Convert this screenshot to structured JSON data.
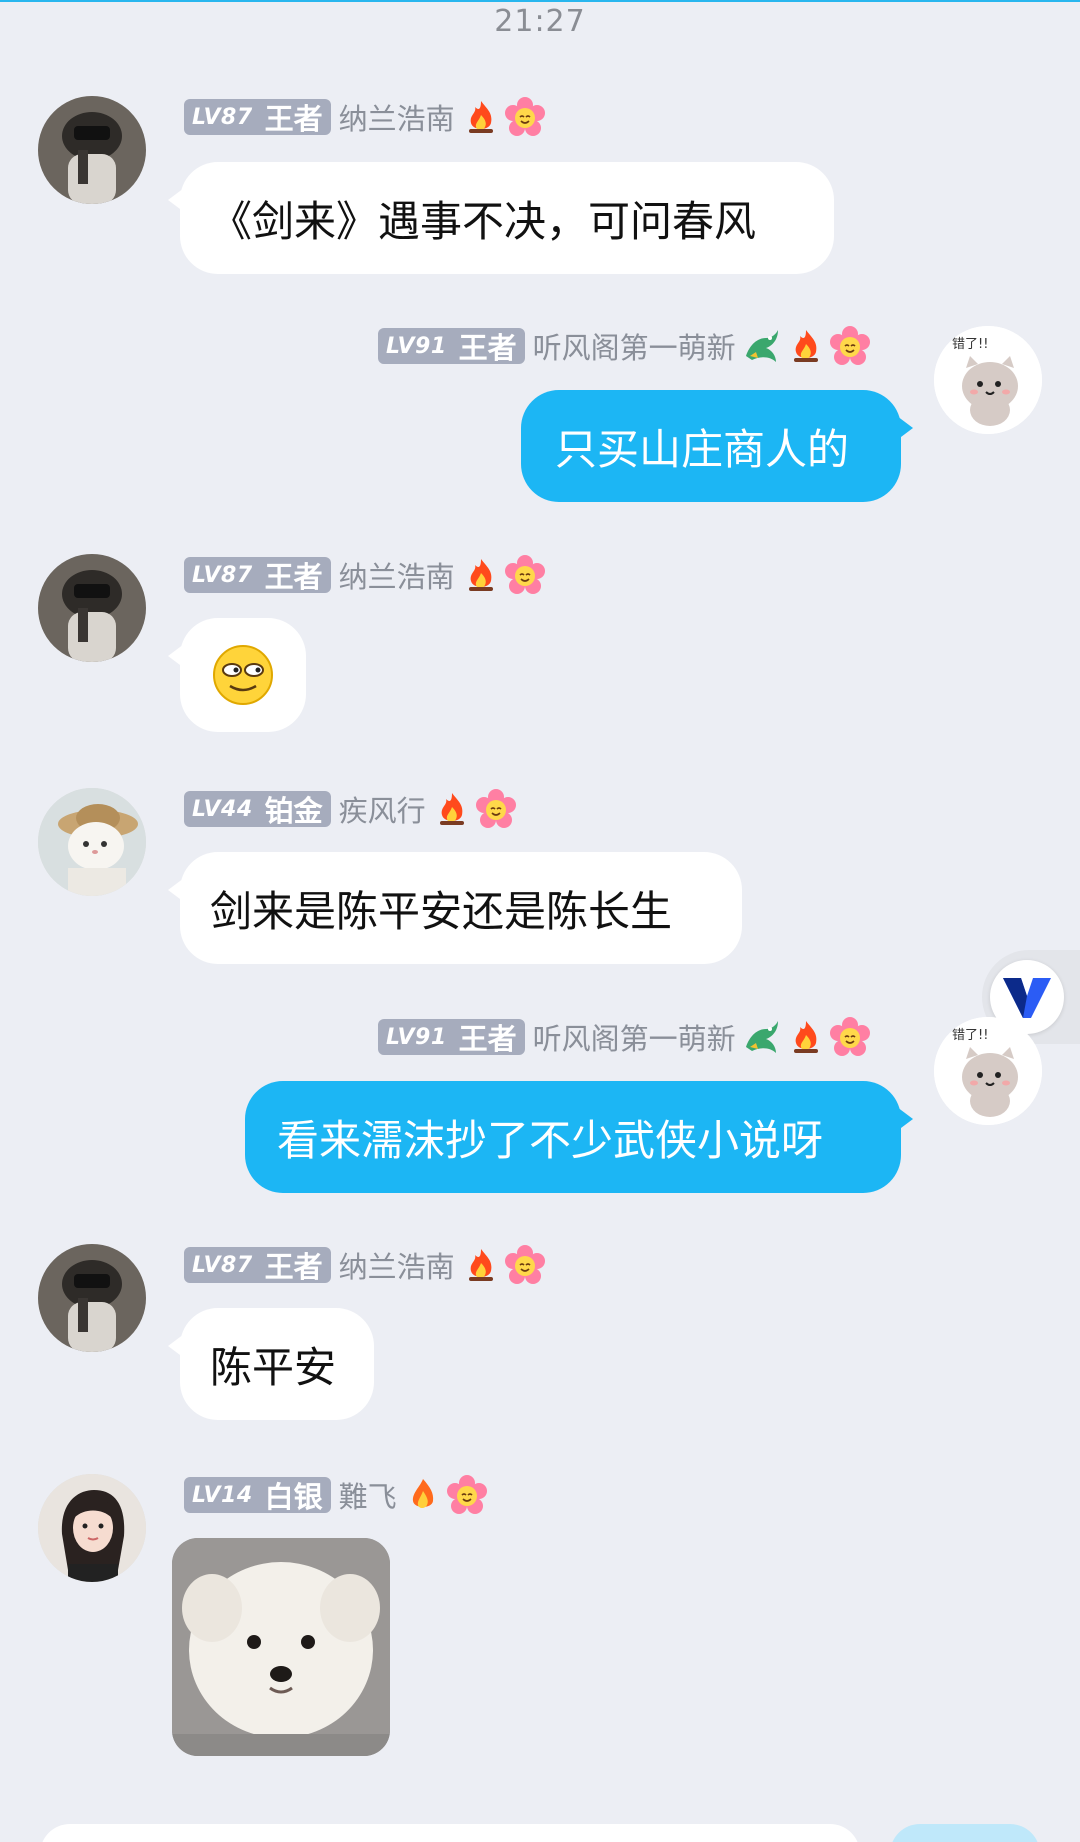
{
  "status": {
    "time": "21:27"
  },
  "messages": [
    {
      "side": "left",
      "level": "LV87",
      "rank": "王者",
      "nickname": "纳兰浩南",
      "text": "《剑来》遇事不决，可问春风"
    },
    {
      "side": "right",
      "level": "LV91",
      "rank": "王者",
      "nickname": "听风阁第一萌新",
      "text": "只买山庄商人的"
    },
    {
      "side": "left",
      "level": "LV87",
      "rank": "王者",
      "nickname": "纳兰浩南",
      "content_type": "emoji",
      "emoji": "smirk-face-emoji"
    },
    {
      "side": "left",
      "level": "LV44",
      "rank": "铂金",
      "nickname": "疾风行",
      "text": "剑来是陈平安还是陈长生"
    },
    {
      "side": "right",
      "level": "LV91",
      "rank": "王者",
      "nickname": "听风阁第一萌新",
      "text": "看来濡沫抄了不少武侠小说呀"
    },
    {
      "side": "left",
      "level": "LV87",
      "rank": "王者",
      "nickname": "纳兰浩南",
      "text": "陈平安"
    },
    {
      "side": "left",
      "level": "LV14",
      "rank": "白银",
      "nickname": "難飞",
      "content_type": "sticker",
      "sticker": "white-puppy-sticker"
    }
  ],
  "self_avatar": {
    "caption": "错了!!"
  },
  "colors": {
    "outgoing_bubble": "#1cb6f4",
    "incoming_bubble": "#ffffff",
    "background": "#eceef4",
    "level_badge": "#a6acbd"
  },
  "icons": {
    "fire": "fire-icon",
    "flower": "flower-face-icon",
    "dragon": "dragon-icon",
    "float": "v-logo-icon"
  }
}
